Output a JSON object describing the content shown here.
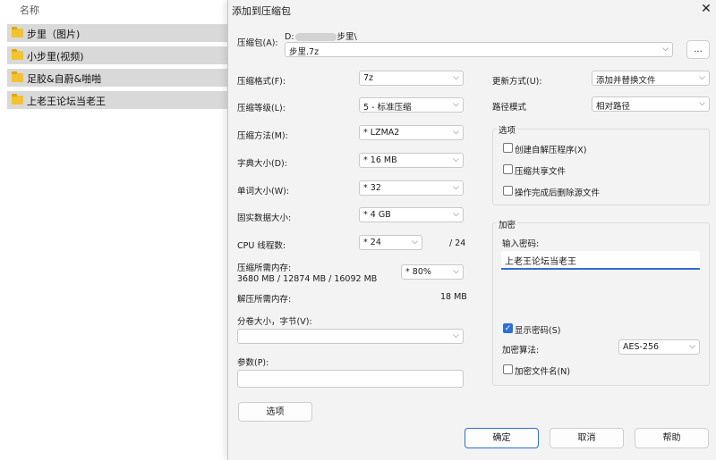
{
  "explorer": {
    "column_header": "名称",
    "folders": [
      "步里（图片)",
      "小步里(视频)",
      "足胶&自蔚&啪啪",
      "上老王论坛当老王"
    ]
  },
  "dialog": {
    "title": "添加到压缩包",
    "close_glyph": "✕",
    "archive": {
      "label": "压缩包(A):",
      "path_prefix": "D:",
      "path_suffix": "步里\\",
      "value": "步里.7z",
      "browse_label": "..."
    },
    "left": {
      "format": {
        "label": "压缩格式(F):",
        "value": "7z"
      },
      "level": {
        "label": "压缩等级(L):",
        "value": "5 - 标准压缩"
      },
      "method": {
        "label": "压缩方法(M):",
        "value": "* LZMA2"
      },
      "dict": {
        "label": "字典大小(D):",
        "value": "* 16 MB"
      },
      "word": {
        "label": "单词大小(W):",
        "value": "* 32"
      },
      "solid": {
        "label": "固实数据大小:",
        "value": "* 4 GB"
      },
      "cpu": {
        "label": "CPU 线程数:",
        "value": "* 24",
        "max": "/ 24"
      },
      "mem_compress": {
        "label": "压缩所需内存:",
        "detail": "3680 MB / 12874 MB / 16092 MB",
        "value": "* 80%"
      },
      "mem_decompress": {
        "label": "解压所需内存:",
        "value": "18 MB"
      },
      "volume": {
        "label": "分卷大小，字节(V):",
        "value": ""
      },
      "params": {
        "label": "参数(P):",
        "value": ""
      },
      "options_button": "选项"
    },
    "right": {
      "update": {
        "label": "更新方式(U):",
        "value": "添加并替换文件"
      },
      "path_mode": {
        "label": "路径模式",
        "value": "相对路径"
      },
      "options_group": {
        "title": "选项",
        "items": [
          {
            "label": "创建自解压程序(X)",
            "checked": false
          },
          {
            "label": "压缩共享文件",
            "checked": false
          },
          {
            "label": "操作完成后删除源文件",
            "checked": false
          }
        ]
      },
      "encryption": {
        "title": "加密",
        "password_label": "输入密码:",
        "password_value": "上老王论坛当老王",
        "show_password": {
          "label": "显示密码(S)",
          "checked": true
        },
        "method_label": "加密算法:",
        "method_value": "AES-256",
        "encrypt_names": {
          "label": "加密文件名(N)",
          "checked": false
        }
      }
    },
    "buttons": {
      "ok": "确定",
      "cancel": "取消",
      "help": "帮助"
    }
  }
}
